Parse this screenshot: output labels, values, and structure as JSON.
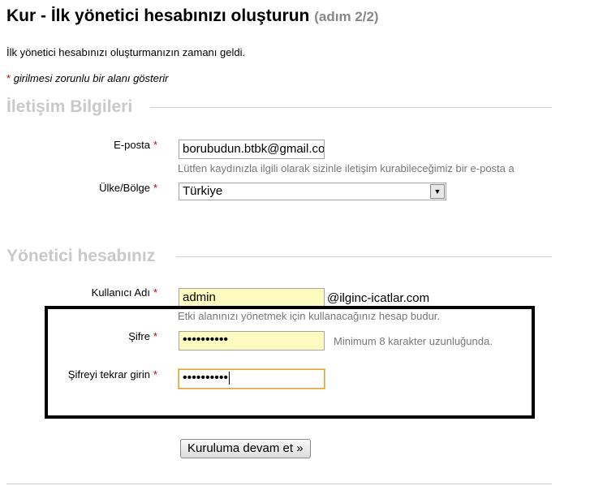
{
  "page": {
    "title": "Kur - İlk yönetici hesabınızı oluşturun",
    "step": "(adım 2/2)",
    "intro": "İlk yönetici hesabınızı oluşturmanızın zamanı geldi.",
    "required_star": "*",
    "required_note": "girilmesi zorunlu bir alanı gösterir"
  },
  "contact_section": {
    "heading": "İletişim Bilgileri",
    "email_label": "E-posta",
    "email_value": "borubudun.btbk@gmail.com",
    "email_help": "Lütfen kaydınızla ilgili olarak sizinle iletişim kurabileceğimiz bir e-posta a",
    "country_label": "Ülke/Bölge",
    "country_value": "Türkiye"
  },
  "admin_section": {
    "heading": "Yönetici hesabınız",
    "username_label": "Kullanıcı Adı",
    "username_value": "admin",
    "domain_suffix": "@ilginc-icatlar.com",
    "username_help": "Etki alanınızı yönetmek için kullanacağınız hesap budur.",
    "password_label": "Şifre",
    "password_value": "••••••••••",
    "password_help": "Minimum 8 karakter uzunluğunda.",
    "password_confirm_label": "Şifreyi tekrar girin",
    "password_confirm_value": "••••••••••"
  },
  "actions": {
    "continue_label": "Kuruluma devam et »"
  },
  "icons": {
    "select_arrow": "chevron-down-icon"
  },
  "colors": {
    "required": "#cc0000",
    "section_heading": "#c9c9c9",
    "field_fill": "#fdfbbf",
    "focus_border": "#e2a33e"
  }
}
